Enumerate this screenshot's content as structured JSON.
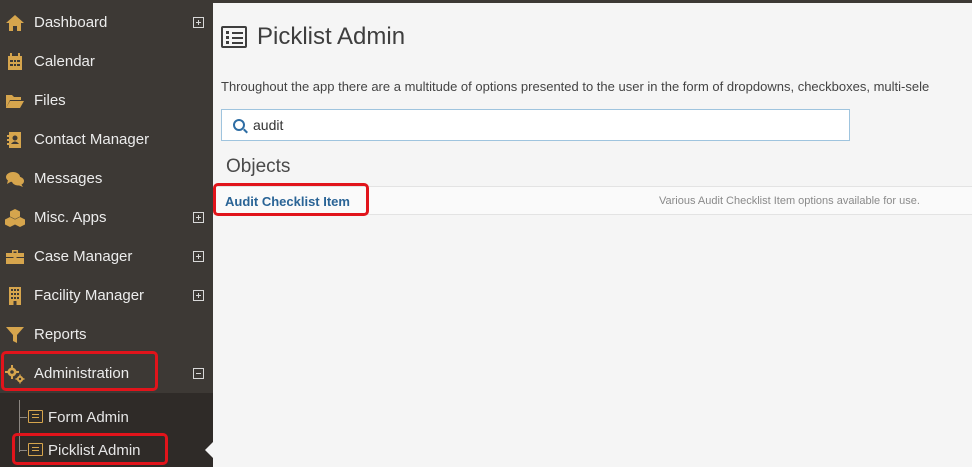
{
  "sidebar": {
    "items": [
      {
        "label": "Dashboard",
        "icon": "home-icon",
        "expander": "plus"
      },
      {
        "label": "Calendar",
        "icon": "calendar-icon",
        "expander": ""
      },
      {
        "label": "Files",
        "icon": "folder-open-icon",
        "expander": ""
      },
      {
        "label": "Contact Manager",
        "icon": "contact-card-icon",
        "expander": ""
      },
      {
        "label": "Messages",
        "icon": "chat-bubbles-icon",
        "expander": ""
      },
      {
        "label": "Misc. Apps",
        "icon": "cubes-icon",
        "expander": "plus"
      },
      {
        "label": "Case Manager",
        "icon": "briefcase-icon",
        "expander": "plus"
      },
      {
        "label": "Facility Manager",
        "icon": "building-icon",
        "expander": "plus"
      },
      {
        "label": "Reports",
        "icon": "filter-icon",
        "expander": ""
      },
      {
        "label": "Administration",
        "icon": "gears-icon",
        "expander": "minus"
      }
    ],
    "subitems": [
      {
        "label": "Form Admin",
        "icon": "list-icon"
      },
      {
        "label": "Picklist Admin",
        "icon": "list-icon",
        "active": true
      }
    ],
    "icon_color": "#d6a54d"
  },
  "page": {
    "title": "Picklist Admin",
    "title_icon": "list-alt-icon",
    "description": "Throughout the app there are a multitude of options presented to the user in the form of dropdowns, checkboxes, multi-sele",
    "search": {
      "value": "audit",
      "icon": "search-icon"
    },
    "section_heading": "Objects",
    "objects": [
      {
        "name": "Audit Checklist Item",
        "description": "Various Audit Checklist Item options available for use."
      }
    ]
  },
  "colors": {
    "sidebar_bg": "#3d3935",
    "highlight": "#e1141b",
    "link": "#2a6496"
  }
}
